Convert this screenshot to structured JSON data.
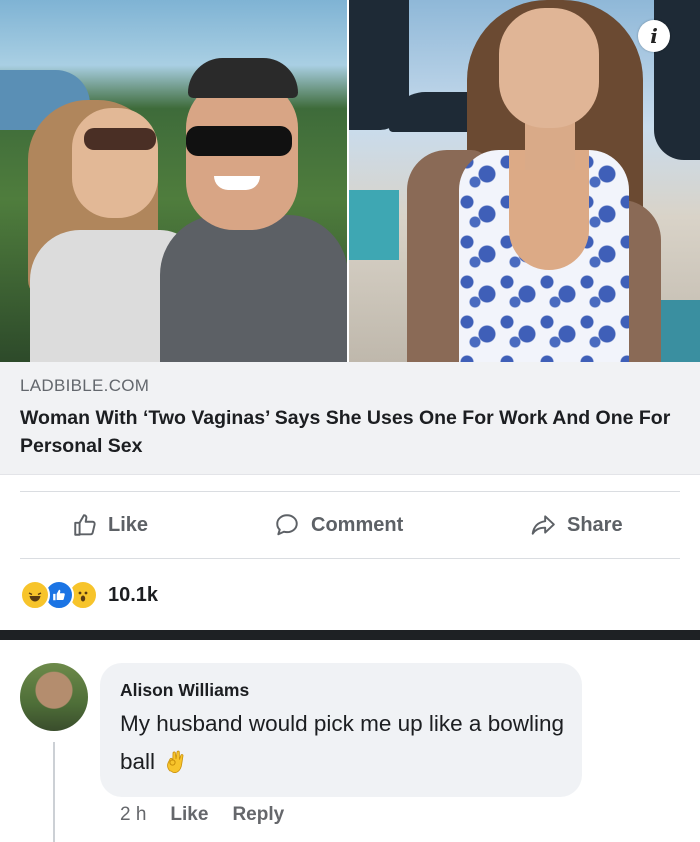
{
  "link_preview": {
    "info_glyph": "i",
    "domain": "LADBIBLE.COM",
    "headline": "Woman With ‘Two Vaginas’ Says She Uses One For Work And One For Personal Sex"
  },
  "actions": {
    "like": "Like",
    "comment": "Comment",
    "share": "Share"
  },
  "reactions": {
    "icons": [
      "haha-reaction-icon",
      "like-reaction-icon",
      "wow-reaction-icon"
    ],
    "count": "10.1k"
  },
  "comment": {
    "author": "Alison Williams",
    "text": "My husband would pick me up like a bowling ball",
    "emoji": "ok-hand-icon",
    "time": "2 h",
    "like_label": "Like",
    "reply_label": "Reply"
  },
  "colors": {
    "like_blue": "#1b74e4",
    "text_secondary": "#65676b",
    "bubble_bg": "#f0f2f5"
  }
}
